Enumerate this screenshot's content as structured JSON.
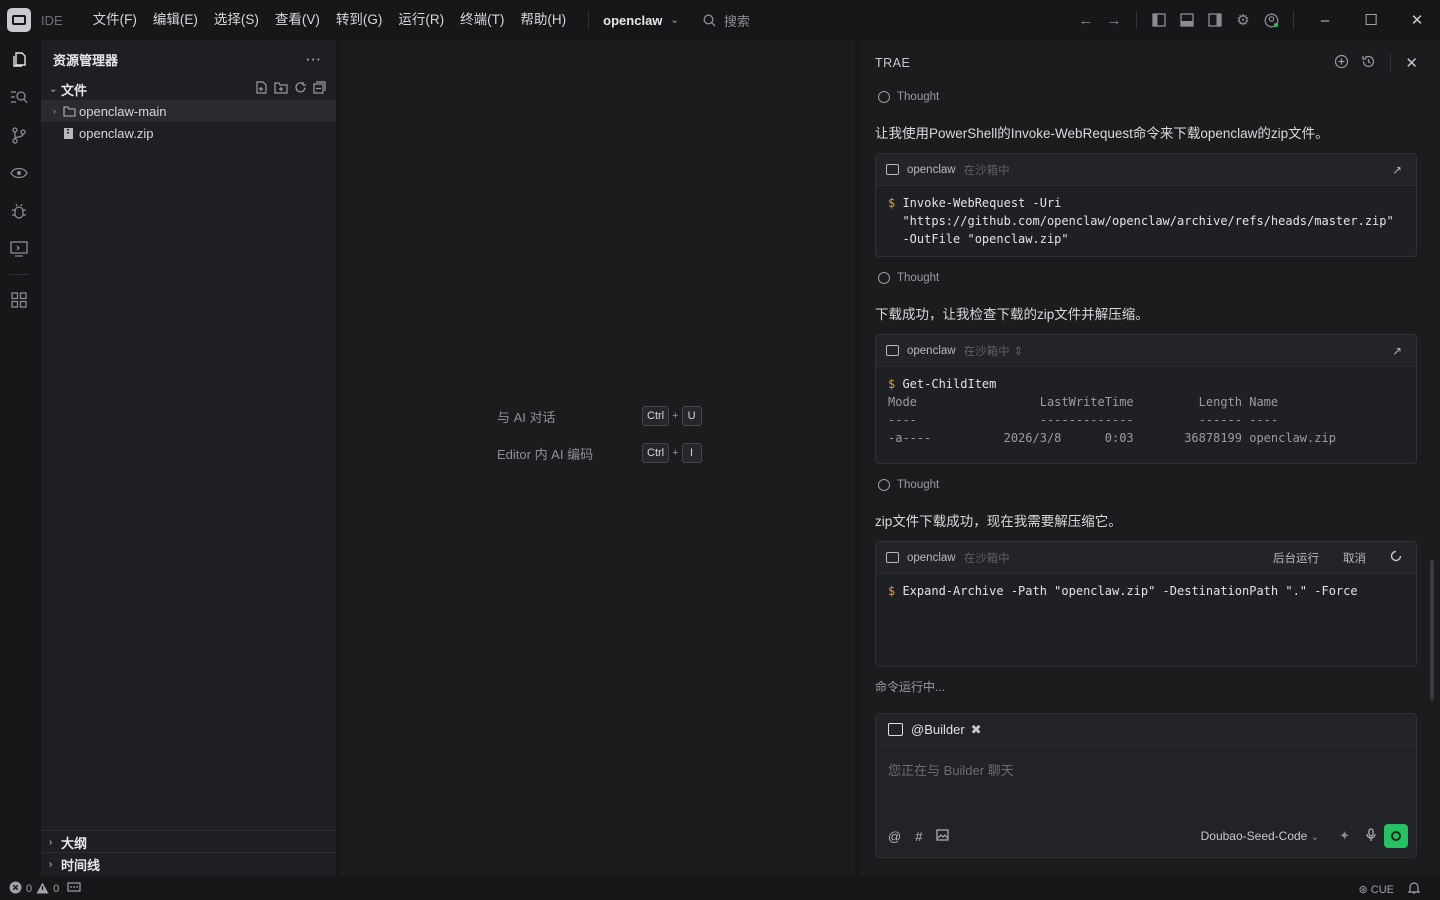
{
  "titlebar": {
    "ide_label": "IDE",
    "menu": [
      "文件(F)",
      "编辑(E)",
      "选择(S)",
      "查看(V)",
      "转到(G)",
      "运行(R)",
      "终端(T)",
      "帮助(H)"
    ],
    "project": "openclaw",
    "search_placeholder": "搜索"
  },
  "explorer": {
    "title": "资源管理器",
    "more": "···",
    "files_section": "文件",
    "tree": [
      {
        "name": "openclaw-main",
        "type": "folder"
      },
      {
        "name": "openclaw.zip",
        "type": "file"
      }
    ],
    "outline_section": "大纲",
    "timeline_section": "时间线"
  },
  "editor": {
    "hints": [
      {
        "label": "与 AI 对话",
        "keys": [
          "Ctrl",
          "U"
        ]
      },
      {
        "label": "Editor 内 AI 编码",
        "keys": [
          "Ctrl",
          "I"
        ]
      }
    ]
  },
  "ai_panel": {
    "title": "TRAE",
    "thought_label": "Thought",
    "messages": [
      "让我使用PowerShell的Invoke-WebRequest命令来下载openclaw的zip文件。",
      "下载成功，让我检查下载的zip文件并解压缩。",
      "zip文件下载成功，现在我需要解压缩它。"
    ],
    "terminals": [
      {
        "name": "openclaw",
        "status": "在沙箱中",
        "lines": [
          "Invoke-WebRequest -Uri",
          "\"https://github.com/openclaw/openclaw/archive/refs/heads/master.zip\"",
          "-OutFile \"openclaw.zip\""
        ]
      },
      {
        "name": "openclaw",
        "status": "在沙箱中",
        "command": "Get-ChildItem",
        "output": [
          "Mode                 LastWriteTime         Length Name",
          "----                 -------------         ------ ----",
          "-a----          2026/3/8      0:03       36878199 openclaw.zip"
        ]
      },
      {
        "name": "openclaw",
        "status": "在沙箱中",
        "background_label": "后台运行",
        "cancel_label": "取消",
        "command": "Expand-Archive -Path \"openclaw.zip\" -DestinationPath \".\" -Force"
      }
    ],
    "running_status": "命令运行中...",
    "chat": {
      "agent": "@Builder",
      "placeholder": "您正在与 Builder 聊天",
      "model": "Doubao-Seed-Code"
    }
  },
  "statusbar": {
    "errors": "0",
    "warnings": "0",
    "cue": "CUE"
  },
  "colors": {
    "background": "#17171a",
    "panel": "#1c1c1f",
    "accent_green": "#27c164",
    "dollar": "#d4a13a"
  }
}
